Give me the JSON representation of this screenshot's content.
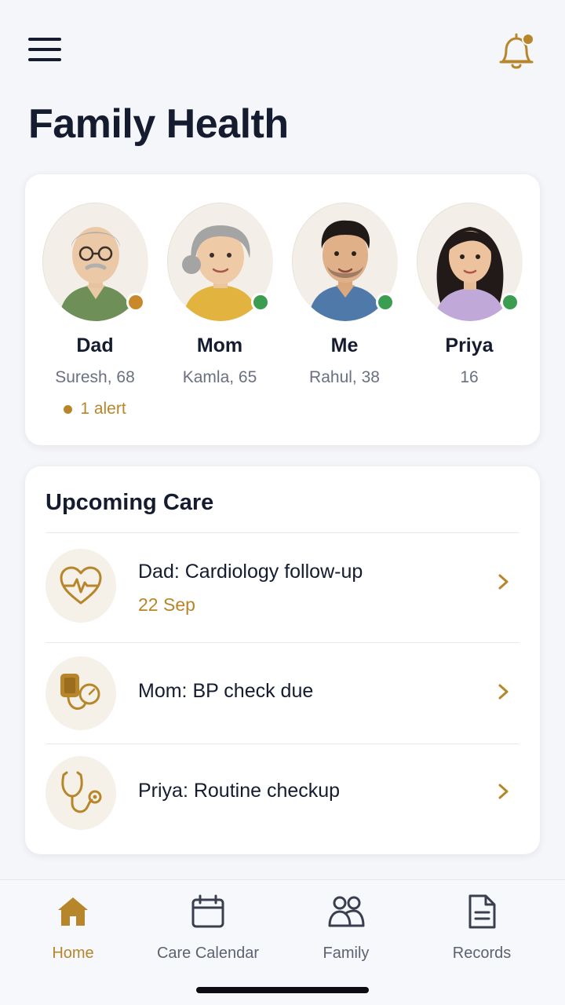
{
  "header": {
    "title": "Family Health",
    "menu_icon": "hamburger-menu-icon",
    "notification_icon": "bell-icon",
    "notification_dot_color": "#b8862a"
  },
  "members": [
    {
      "label": "Dad",
      "sub": "Suresh, 68",
      "status_color": "#c8892b",
      "alert": "1 alert"
    },
    {
      "label": "Mom",
      "sub": "Kamla, 65",
      "status_color": "#3a9d4f"
    },
    {
      "label": "Me",
      "sub": "Rahul, 38",
      "status_color": "#3a9d4f"
    },
    {
      "label": "Priya",
      "sub": "16",
      "status_color": "#3a9d4f"
    }
  ],
  "care": {
    "title": "Upcoming Care",
    "items": [
      {
        "text": "Dad: Cardiology follow-up",
        "date": "22 Sep",
        "icon": "heartbeat-icon"
      },
      {
        "text": "Mom: BP check due",
        "icon": "blood-pressure-monitor-icon"
      },
      {
        "text": "Priya: Routine checkup",
        "icon": "stethoscope-icon"
      }
    ]
  },
  "nav": {
    "items": [
      {
        "label": "Home",
        "icon": "home-icon",
        "active": true
      },
      {
        "label": "Care Calendar",
        "icon": "calendar-icon"
      },
      {
        "label": "Family",
        "icon": "people-icon"
      },
      {
        "label": "Records",
        "icon": "document-icon"
      }
    ]
  },
  "colors": {
    "accent": "#b8862a",
    "text_primary": "#151c30",
    "background": "#f5f6f9"
  }
}
